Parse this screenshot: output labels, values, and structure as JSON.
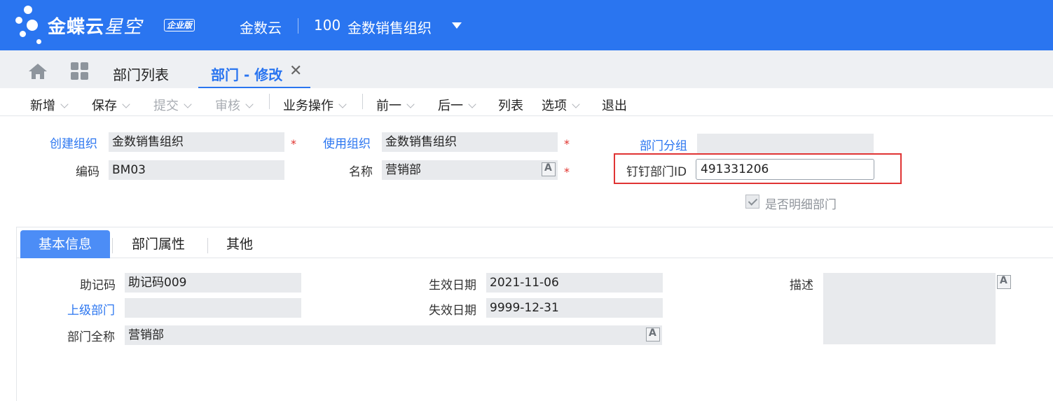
{
  "header": {
    "logo_main": "金蝶云",
    "logo_sub": "星空",
    "logo_badge": "企业版",
    "cloud_name": "金数云",
    "org_code": "100",
    "org_name": "金数销售组织"
  },
  "tabs": {
    "list_label": "部门列表",
    "active_label": "部门 - 修改",
    "close_glyph": "✕"
  },
  "toolbar": {
    "new": "新增",
    "save": "保存",
    "submit": "提交",
    "audit": "审核",
    "business_ops": "业务操作",
    "prev": "前一",
    "next": "后一",
    "list": "列表",
    "options": "选项",
    "exit": "退出"
  },
  "form": {
    "create_org_label": "创建组织",
    "create_org_value": "金数销售组织",
    "use_org_label": "使用组织",
    "use_org_value": "金数销售组织",
    "dept_group_label": "部门分组",
    "dept_group_value": "",
    "code_label": "编码",
    "code_value": "BM03",
    "name_label": "名称",
    "name_value": "营销部",
    "dingtalk_label": "钉钉部门ID",
    "dingtalk_value": "491331206",
    "detail_dept_label": "是否明细部门",
    "detail_dept_checked": true,
    "required_mark": "*"
  },
  "subtabs": {
    "basic": "基本信息",
    "attributes": "部门属性",
    "other": "其他"
  },
  "basic_info": {
    "mnemonic_label": "助记码",
    "mnemonic_value": "助记码009",
    "parent_dept_label": "上级部门",
    "parent_dept_value": "",
    "full_name_label": "部门全称",
    "full_name_value": "营销部",
    "effective_date_label": "生效日期",
    "effective_date_value": "2021-11-06",
    "expiry_date_label": "失效日期",
    "expiry_date_value": "9999-12-31",
    "description_label": "描述",
    "description_value": ""
  },
  "colors": {
    "brand_blue": "#2a75f0",
    "active_subtab": "#4c8df6",
    "required_red": "#e0302b",
    "highlight_red": "#e03434"
  }
}
